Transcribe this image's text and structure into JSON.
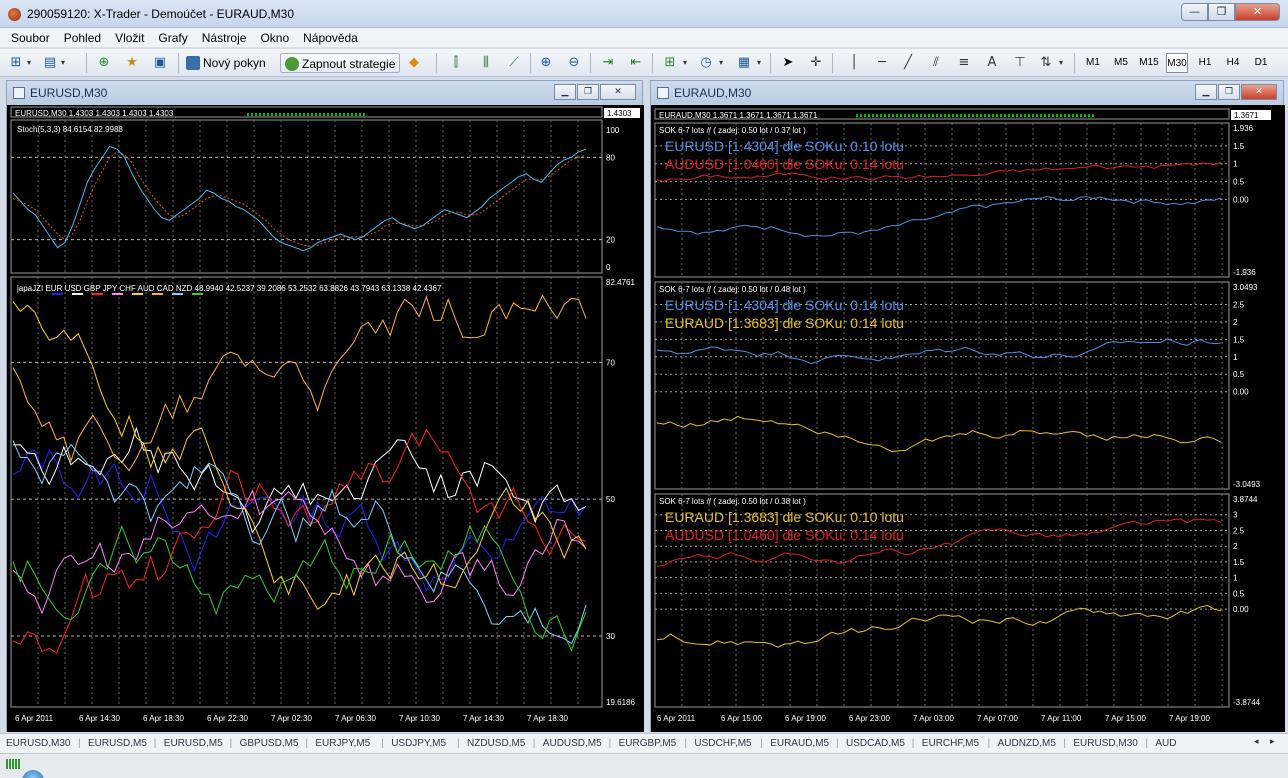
{
  "window": {
    "title": "290059120: X-Trader - Demoúčet - EURAUD,M30"
  },
  "menu": [
    "Soubor",
    "Pohled",
    "Vložit",
    "Grafy",
    "Nástroje",
    "Okno",
    "Nápověda"
  ],
  "toolbar": {
    "new_order_label": "Nový pokyn",
    "strategy_label": "Zapnout strategie",
    "timeframes": [
      "M1",
      "M5",
      "M15",
      "M30",
      "H1",
      "H4",
      "D1"
    ],
    "active_timeframe": "M30",
    "text_tool_label": "A"
  },
  "left_window": {
    "title": "EURUSD,M30",
    "symbol_line": "EURUSD,M30  1.4303 1.4303 1.4303 1.4303",
    "price_tag": "1.4303",
    "stoch": {
      "label": "Stoch(5,3,3) 84.6154 82.9988",
      "levels": [
        "100",
        "80",
        "20",
        "0"
      ],
      "main": [
        54,
        48,
        42,
        38,
        30,
        22,
        14,
        18,
        30,
        46,
        62,
        72,
        80,
        88,
        86,
        80,
        68,
        58,
        50,
        42,
        36,
        34,
        38,
        42,
        46,
        50,
        56,
        54,
        50,
        48,
        44,
        42,
        38,
        34,
        28,
        22,
        18,
        16,
        14,
        12,
        14,
        18,
        20,
        22,
        24,
        22,
        20,
        22,
        26,
        30,
        34,
        36,
        32,
        30,
        28,
        30,
        34,
        38,
        42,
        40,
        38,
        36,
        40,
        44,
        50,
        54,
        58,
        62,
        66,
        68,
        64,
        62,
        68,
        74,
        78,
        80,
        84,
        86
      ],
      "signal": [
        50,
        48,
        45,
        42,
        36,
        30,
        24,
        20,
        24,
        34,
        48,
        60,
        70,
        80,
        84,
        82,
        76,
        66,
        58,
        50,
        44,
        38,
        36,
        38,
        42,
        46,
        50,
        52,
        52,
        50,
        48,
        46,
        42,
        38,
        34,
        28,
        24,
        20,
        18,
        16,
        15,
        16,
        18,
        20,
        22,
        22,
        22,
        22,
        24,
        26,
        30,
        32,
        32,
        31,
        30,
        30,
        32,
        34,
        38,
        40,
        40,
        38,
        38,
        40,
        44,
        48,
        52,
        56,
        60,
        64,
        64,
        64,
        66,
        70,
        74,
        78,
        80,
        82
      ]
    },
    "currency_index": {
      "label": "japaJZI  EUR USD GBP JPY CHF AUD CAD NZD  48.9940 42.5237 39.2086 53.2532 63.8826 43.7943 63.1338 42.4367",
      "names": [
        "EUR",
        "USD",
        "GBP",
        "JPY",
        "CHF",
        "AUD",
        "CAD",
        "NZD"
      ],
      "colors": [
        "#2020ff",
        "#ffffff",
        "#ff2020",
        "#ff80ff",
        "#ffd020",
        "#ffb040",
        "#80d0ff",
        "#30d030"
      ],
      "levels": [
        "70",
        "50",
        "30"
      ],
      "max_label": "82.4761",
      "min_label": "19.6186",
      "range": [
        19.6186,
        82.4761
      ]
    },
    "time_axis": [
      "6 Apr 2011",
      "6 Apr 14:30",
      "6 Apr 18:30",
      "6 Apr 22:30",
      "7 Apr 02:30",
      "7 Apr 06:30",
      "7 Apr 10:30",
      "7 Apr 14:30",
      "7 Apr 18:30"
    ]
  },
  "right_window": {
    "title": "EURAUD,M30",
    "symbol_line": "EURAUD,M30  1.3671 1.3671 1.3671 1.3671",
    "price_tag": "1.3671",
    "panels": [
      {
        "header": "SOK 6-7 lots  //  ( zadej: 0.50 lot / 0.37 lot )",
        "line1": "EURUSD [1.4304]  dle SOKu: 0.10 lotu",
        "line2": "AUDUSD [1.0460]  dle SOKu: 0.14 lotu",
        "color1": "#4a90e8",
        "color2": "#e02020",
        "axis": [
          "1.936",
          "1.5",
          "1",
          "0.5",
          "0.00",
          "-1.936"
        ]
      },
      {
        "header": "SOK 6-7 lots  //  ( zadej: 0.50 lot / 0.48 lot )",
        "line1": "EURUSD [1.4304]  dle SOKu: 0.14 lotu",
        "line2": "EURAUD [1.3683]  dle SOKu: 0.14 lotu",
        "color1": "#4a90e8",
        "color2": "#e8c020",
        "axis": [
          "3.0493",
          "2.5",
          "2",
          "1.5",
          "1",
          "0.5",
          "0.00",
          "-3.0493"
        ]
      },
      {
        "header": "SOK 6-7 lots  //  ( zadej: 0.50 lot / 0.38 lot )",
        "line1": "EURAUD [1.3683]  dle SOKu: 0.10 lotu",
        "line2": "AUDUSD [1.0460]  dle SOKu: 0.14 lotu",
        "color1": "#e8c020",
        "color2": "#e02020",
        "axis": [
          "3.8744",
          "3",
          "2.5",
          "2",
          "1.5",
          "1",
          "0.5",
          "0.00",
          "-3.8744"
        ]
      }
    ],
    "time_axis": [
      "6 Apr 2011",
      "6 Apr 15:00",
      "6 Apr 19:00",
      "6 Apr 23:00",
      "7 Apr 03:00",
      "7 Apr 07:00",
      "7 Apr 11:00",
      "7 Apr 15:00",
      "7 Apr 19:00"
    ]
  },
  "tabs": [
    "EURUSD,M30",
    "EURUSD,M5",
    "EURUSD,M5",
    "GBPUSD,M5",
    "EURJPY,M5",
    "USDJPY,M5",
    "NZDUSD,M5",
    "AUDUSD,M5",
    "EURGBP,M5",
    "USDCHF,M5",
    "EURAUD,M5",
    "USDCAD,M5",
    "EURCHF,M5",
    "AUDNZD,M5",
    "EURUSD,M30",
    "AUD"
  ],
  "colors": {
    "grid": "#6a6a6a",
    "axis_text": "#ffffff",
    "chart_bg": "#000000",
    "stoch_main": "#48b8f0",
    "stoch_signal": "#e05020"
  }
}
